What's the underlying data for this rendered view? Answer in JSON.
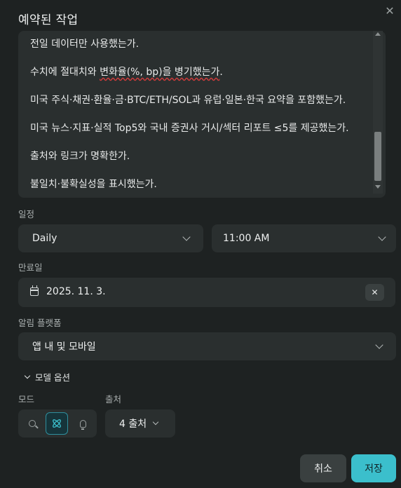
{
  "dialog": {
    "title": "예약된 작업",
    "close_icon": "close-icon"
  },
  "prompt": {
    "lines": [
      "전일 데이터만 사용했는가.",
      "수치에 절대치와 변화율(%, bp)을 병기했는가.",
      "미국 주식·채권·환율·금·BTC/ETH/SOL과 유럽·일본·한국 요약을 포함했는가.",
      "미국 뉴스·지표·실적 Top5와 국내 증권사 거시/섹터 리포트 ≤5를 제공했는가.",
      "출처와 링크가 명확한가.",
      "불일치·불확실성을 표시했는가."
    ],
    "line2_before": "수치에 절대치와 ",
    "line2_flagged": "변화율(%, bp)을 병기했는가",
    "line2_after": "."
  },
  "schedule": {
    "label": "일정",
    "frequency": "Daily",
    "time": "11:00 AM"
  },
  "expiry": {
    "label": "만료일",
    "date": "2025. 11. 3.",
    "clear_icon": "close-icon"
  },
  "notify": {
    "label": "알림 플랫폼",
    "value": "앱 내 및 모바일"
  },
  "model_options": {
    "toggle_label": "모델 옵션",
    "mode_label": "모드",
    "modes": [
      "search-icon",
      "atom-icon",
      "lightbulb-icon"
    ],
    "active_mode": "atom-icon",
    "source_label": "출처",
    "source_value": "4 출처"
  },
  "actions": {
    "cancel": "취소",
    "save": "저장"
  },
  "colors": {
    "accent": "#3bbfcc",
    "background": "#1e2222",
    "field": "#2a2f2f"
  }
}
